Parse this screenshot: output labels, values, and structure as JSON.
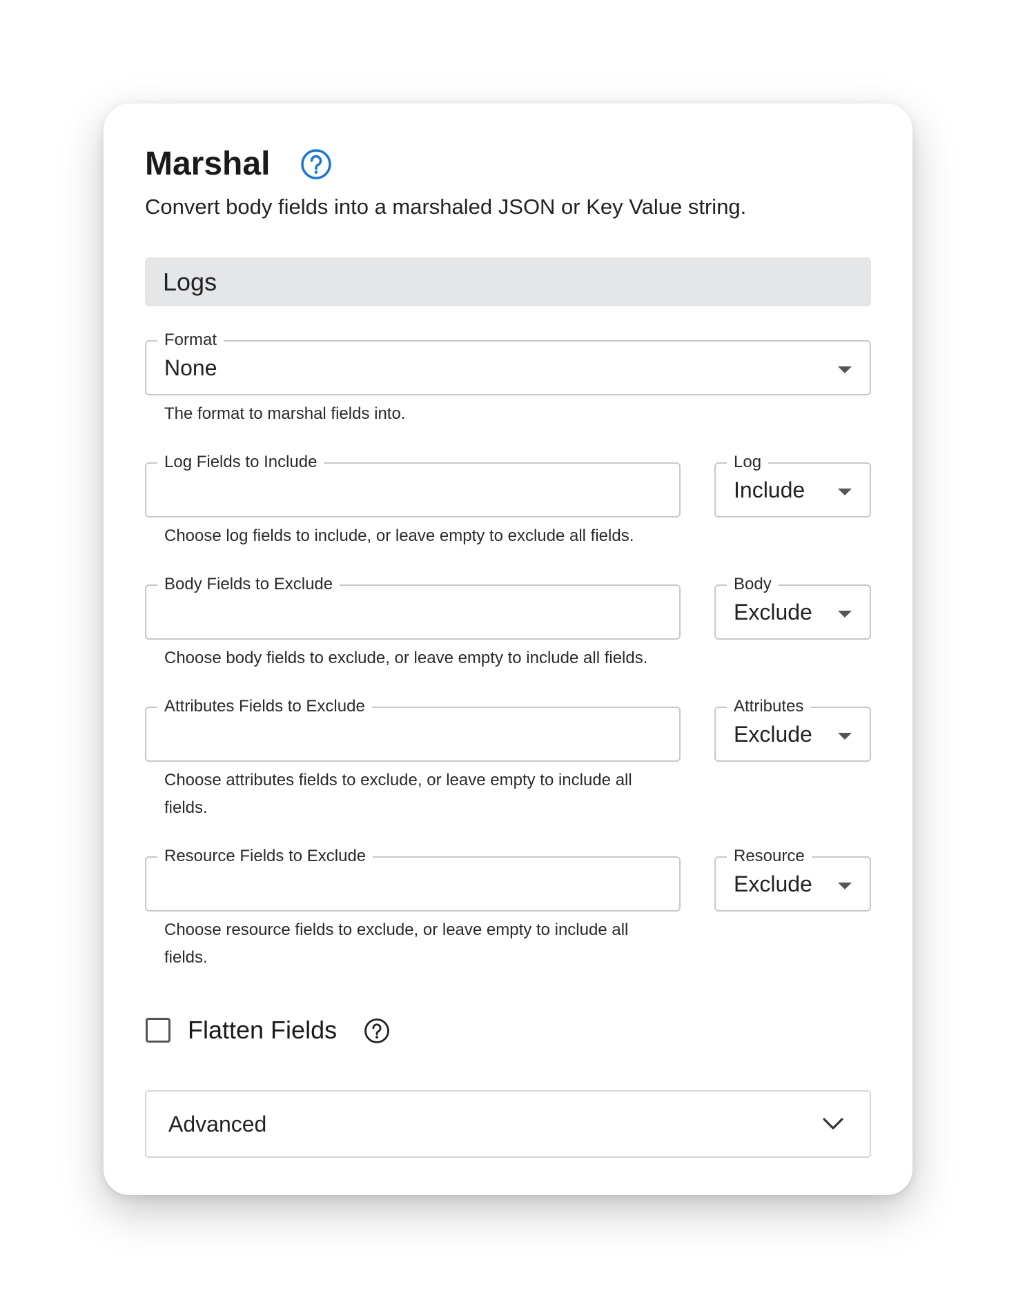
{
  "header": {
    "title": "Marshal",
    "subtitle": "Convert body fields into a marshaled JSON or Key Value string.",
    "help_icon": "question-circle-icon"
  },
  "section": {
    "title": "Logs"
  },
  "format": {
    "label": "Format",
    "value": "None",
    "helper": "The format to marshal fields into."
  },
  "rows": [
    {
      "field_label": "Log Fields to Include",
      "field_value": "",
      "select_label": "Log",
      "select_value": "Include",
      "helper_line1": "Choose log fields to include, or leave empty to exclude all fields.",
      "helper_line2": ""
    },
    {
      "field_label": "Body Fields to Exclude",
      "field_value": "",
      "select_label": "Body",
      "select_value": "Exclude",
      "helper_line1": "Choose body fields to exclude, or leave empty to include all fields.",
      "helper_line2": ""
    },
    {
      "field_label": "Attributes Fields to Exclude",
      "field_value": "",
      "select_label": "Attributes",
      "select_value": "Exclude",
      "helper_line1": "Choose attributes fields to exclude, or leave empty to include all",
      "helper_line2": "fields."
    },
    {
      "field_label": "Resource Fields to Exclude",
      "field_value": "",
      "select_label": "Resource",
      "select_value": "Exclude",
      "helper_line1": "Choose resource fields to exclude, or leave empty to include all",
      "helper_line2": "fields."
    }
  ],
  "flatten": {
    "label": "Flatten Fields",
    "checked": false
  },
  "advanced": {
    "label": "Advanced"
  },
  "colors": {
    "accent": "#1976d2",
    "section_bg": "#e5e6e8",
    "border": "#c8c8c8"
  }
}
